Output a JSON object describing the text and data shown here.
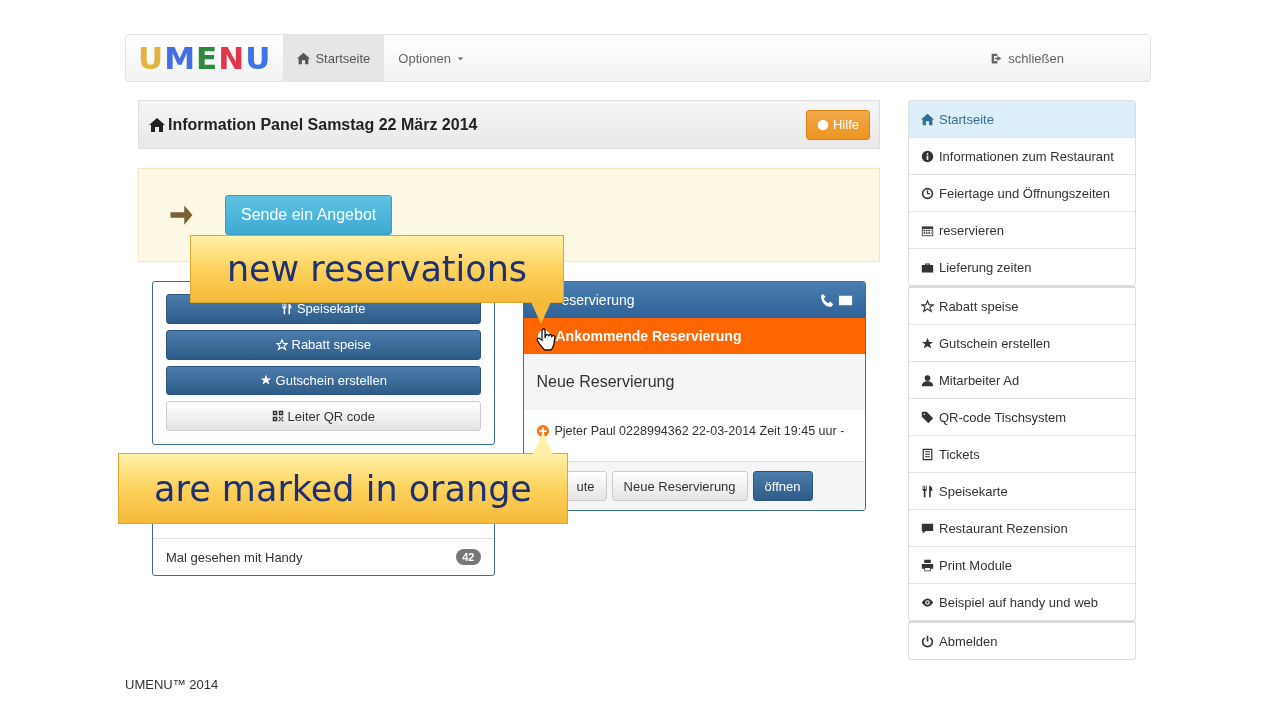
{
  "navbar": {
    "logo": [
      {
        "letter": "U",
        "color": "#e2b43c"
      },
      {
        "letter": "M",
        "color": "#3f6fe0"
      },
      {
        "letter": "E",
        "color": "#2b8a3e"
      },
      {
        "letter": "N",
        "color": "#e2354c"
      },
      {
        "letter": "U",
        "color": "#3f74e6"
      }
    ],
    "items": [
      {
        "label": "Startseite",
        "kind": "home",
        "selected": true
      },
      {
        "label": "Optionen",
        "kind": "dropdown",
        "selected": false
      }
    ],
    "logout": "schließen"
  },
  "info_panel": {
    "title": "Information Panel Samstag 22 März 2014",
    "help": "Hilfe"
  },
  "offer_button": "Sende ein Angebot",
  "menu_panel": {
    "buttons": [
      {
        "label": "Speisekarte",
        "kind": "primary"
      },
      {
        "label": "Rabatt speise",
        "kind": "primary"
      },
      {
        "label": "Gutschein erstellen",
        "kind": "primary"
      },
      {
        "label": "Leiter QR code",
        "kind": "default"
      }
    ]
  },
  "stats_panel": {
    "rows": [
      {
        "label": "Mal gesehen mit Handy",
        "count": "42"
      }
    ]
  },
  "reservation_panel": {
    "title": "eservierung",
    "alert": "Ankommende Reservierung",
    "section": "Neue Reservierung",
    "entries": [
      "Pjeter Paul 0228994362 22-03-2014 Zeit 19:45 uur -"
    ],
    "buttons": [
      {
        "label": "ute",
        "kind": "default"
      },
      {
        "label": "Neue Reservierung",
        "kind": "default"
      },
      {
        "label": "öffnen",
        "kind": "primary"
      }
    ]
  },
  "sidebar": {
    "groups": [
      [
        {
          "label": "Startseite",
          "selected": true
        },
        {
          "label": "Informationen zum Restaurant",
          "selected": false
        },
        {
          "label": "Feiertage und Öffnungszeiten",
          "selected": false
        },
        {
          "label": "reservieren",
          "selected": false
        },
        {
          "label": "Lieferung zeiten",
          "selected": false
        }
      ],
      [
        {
          "label": "Rabatt speise",
          "selected": false
        },
        {
          "label": "Gutschein erstellen",
          "selected": false
        },
        {
          "label": "Mitarbeiter Ad",
          "selected": false
        },
        {
          "label": "QR-code Tischsystem",
          "selected": false
        },
        {
          "label": "Tickets",
          "selected": false
        },
        {
          "label": "Speisekarte",
          "selected": false
        },
        {
          "label": "Restaurant Rezension",
          "selected": false
        },
        {
          "label": "Print Module",
          "selected": false
        },
        {
          "label": "Beispiel auf handy und web",
          "selected": false
        }
      ],
      [
        {
          "label": "Abmelden",
          "selected": false
        }
      ]
    ]
  },
  "footer": "UMENU™ 2014",
  "callouts": [
    {
      "text": "new reservations",
      "kind": "down"
    },
    {
      "text": "are marked in orange",
      "kind": "up"
    }
  ]
}
